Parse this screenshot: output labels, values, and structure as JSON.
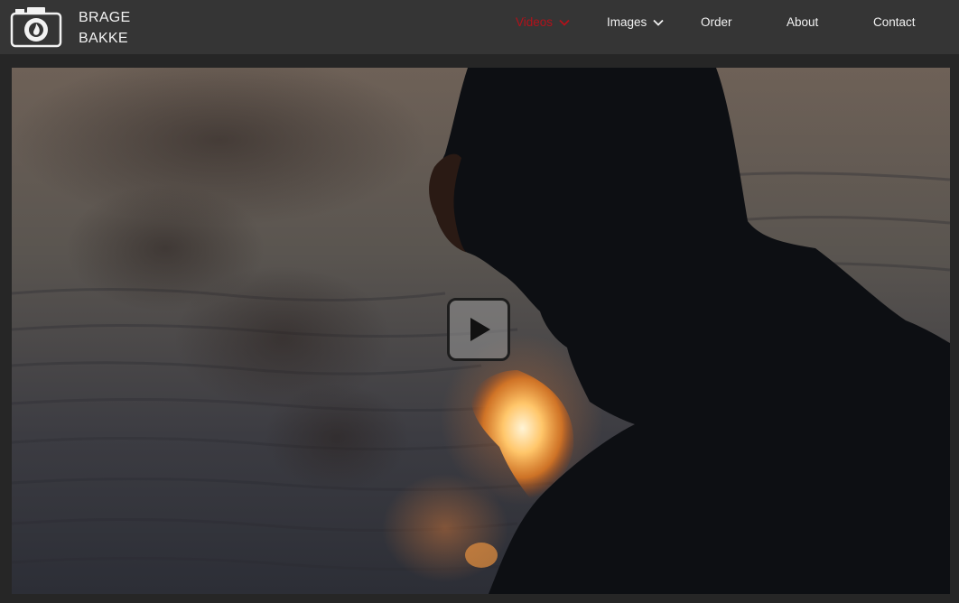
{
  "brand": {
    "line1": "BRAGE",
    "line2": "BAKKE",
    "logo_icon": "camera-logo-icon"
  },
  "nav": {
    "items": [
      {
        "label": "Videos",
        "active": true,
        "has_dropdown": true
      },
      {
        "label": "Images",
        "active": false,
        "has_dropdown": true
      },
      {
        "label": "Order",
        "active": false,
        "has_dropdown": false
      },
      {
        "label": "About",
        "active": false,
        "has_dropdown": false
      },
      {
        "label": "Contact",
        "active": false,
        "has_dropdown": false
      }
    ]
  },
  "video": {
    "play_icon": "play-icon"
  },
  "colors": {
    "header_bg": "#353535",
    "page_bg": "#262626",
    "accent_active": "#b3111a",
    "text": "#f2f2f2"
  }
}
